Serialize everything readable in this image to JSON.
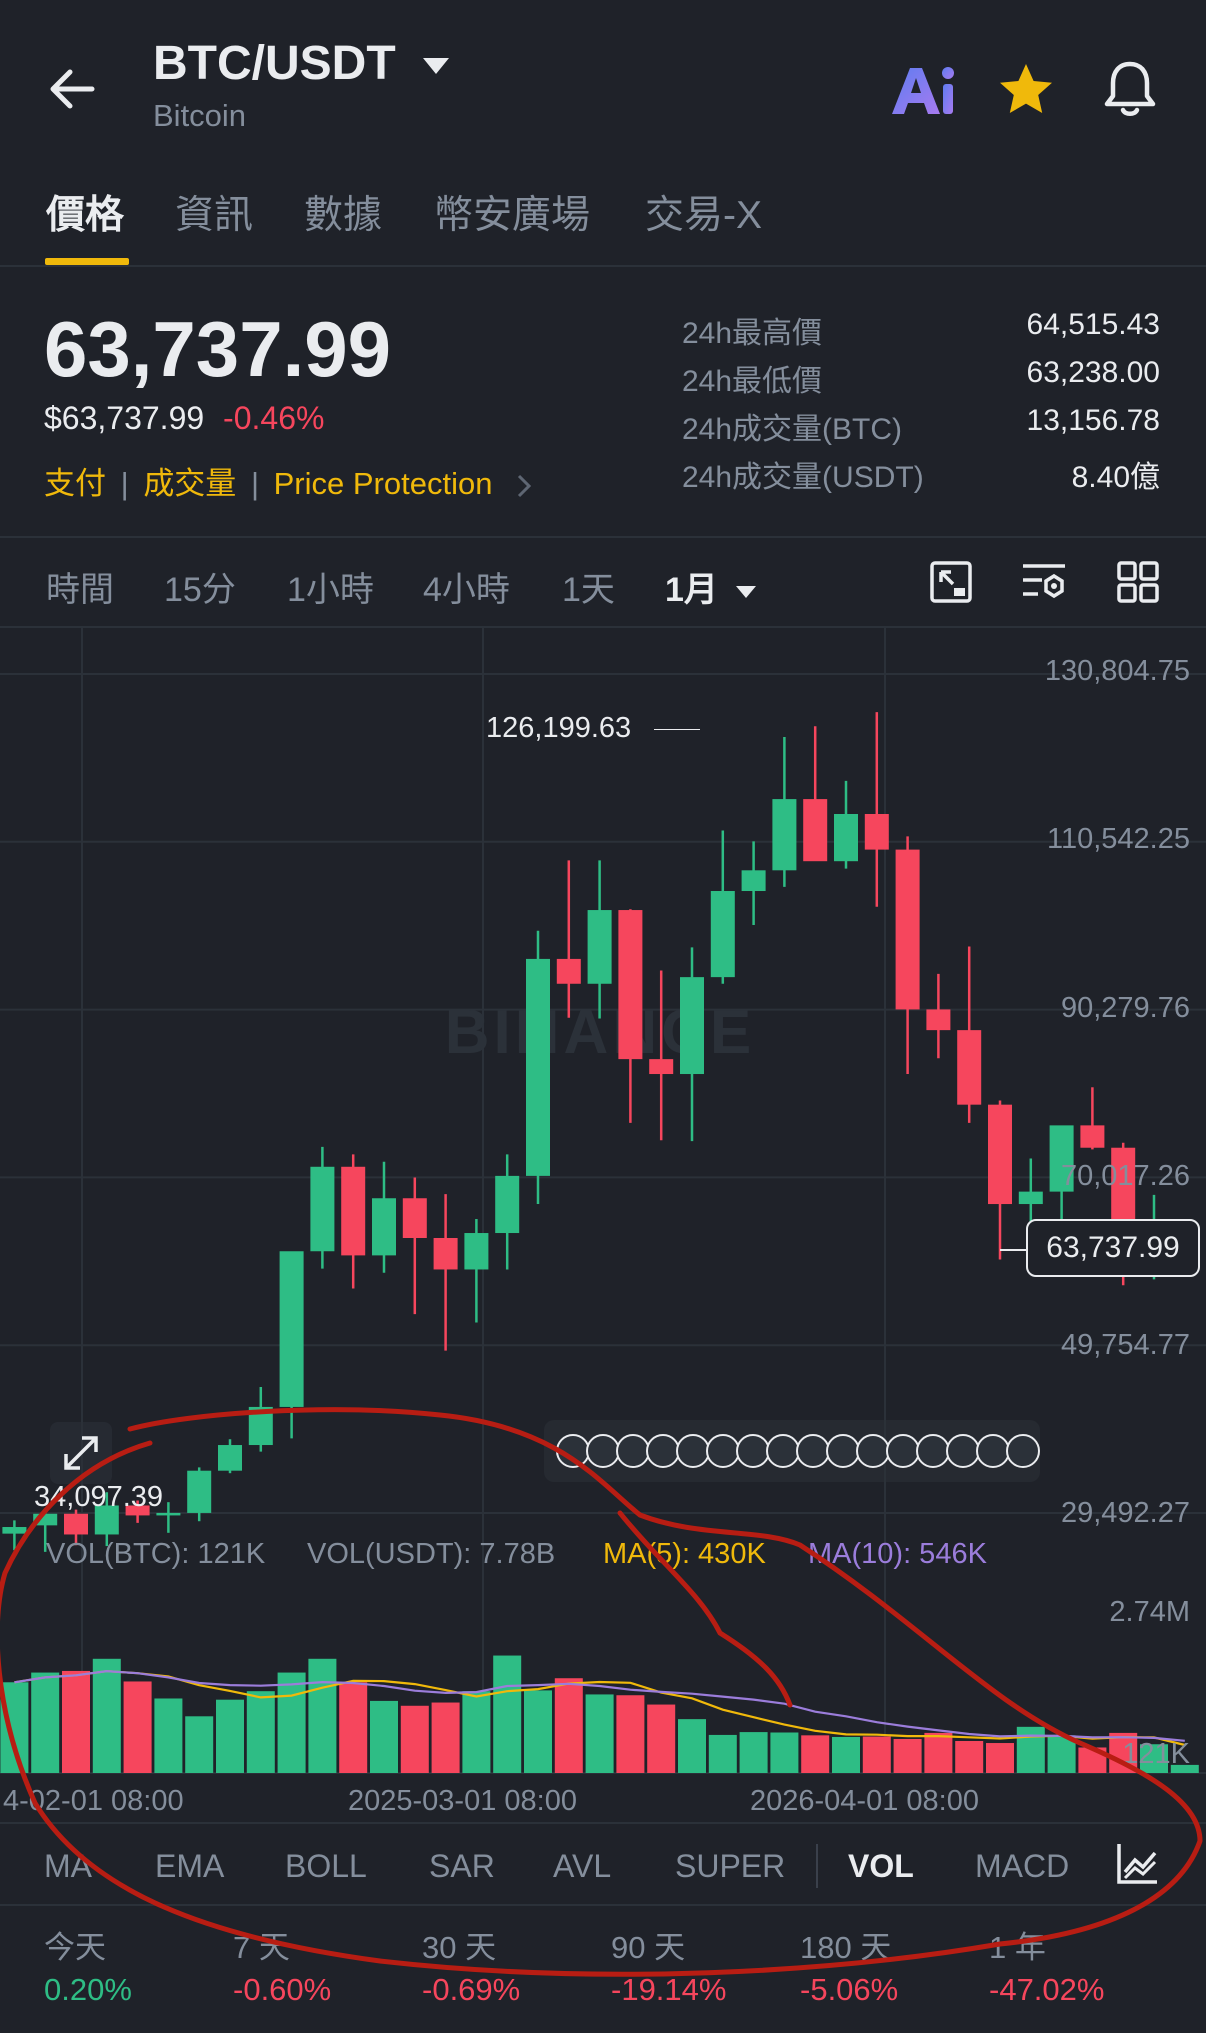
{
  "header": {
    "pair": "BTC/USDT",
    "name": "Bitcoin"
  },
  "tabs": [
    "價格",
    "資訊",
    "數據",
    "幣安廣場",
    "交易-X"
  ],
  "price": {
    "last": "63,737.99",
    "usd": "$63,737.99",
    "change": "-0.46%",
    "links": [
      "支付",
      "成交量",
      "Price Protection"
    ]
  },
  "stats": [
    {
      "label": "24h最高價",
      "value": "64,515.43"
    },
    {
      "label": "24h最低價",
      "value": "63,238.00"
    },
    {
      "label": "24h成交量(BTC)",
      "value": "13,156.78"
    },
    {
      "label": "24h成交量(USDT)",
      "value": "8.40億"
    }
  ],
  "intervals": [
    "時間",
    "15分",
    "1小時",
    "4小時",
    "1天",
    "1月"
  ],
  "chart_data": {
    "type": "candlestick",
    "interval": "1月",
    "watermark": "BINANCE",
    "y_ticks": [
      "130,804.75",
      "110,542.25",
      "90,279.76",
      "70,017.26",
      "49,754.77",
      "29,492.27"
    ],
    "ylim": [
      29492.27,
      130804.75
    ],
    "x_ticks": [
      "4-02-01 08:00",
      "2025-03-01 08:00",
      "2026-04-01 08:00"
    ],
    "high_label": "126,199.63",
    "low_label": "34,097.39",
    "last_price_label": "63,737.99",
    "candles": [
      {
        "o": 27000,
        "h": 28600,
        "l": 25000,
        "c": 27800
      },
      {
        "o": 28000,
        "h": 30000,
        "l": 24800,
        "c": 29400
      },
      {
        "o": 29400,
        "h": 29900,
        "l": 25600,
        "c": 26900
      },
      {
        "o": 26900,
        "h": 32000,
        "l": 25500,
        "c": 30400
      },
      {
        "o": 30400,
        "h": 31000,
        "l": 28300,
        "c": 29200
      },
      {
        "o": 29200,
        "h": 30800,
        "l": 27100,
        "c": 29500
      },
      {
        "o": 29500,
        "h": 35000,
        "l": 28500,
        "c": 34600
      },
      {
        "o": 34600,
        "h": 38400,
        "l": 34300,
        "c": 37700
      },
      {
        "o": 37700,
        "h": 44700,
        "l": 36900,
        "c": 42300
      },
      {
        "o": 42300,
        "h": 48900,
        "l": 38500,
        "c": 61100
      },
      {
        "o": 61100,
        "h": 73700,
        "l": 59000,
        "c": 71300
      },
      {
        "o": 71300,
        "h": 72800,
        "l": 56600,
        "c": 60600
      },
      {
        "o": 60600,
        "h": 71900,
        "l": 58500,
        "c": 67500
      },
      {
        "o": 67500,
        "h": 70000,
        "l": 53500,
        "c": 62700
      },
      {
        "o": 62700,
        "h": 68000,
        "l": 49100,
        "c": 58900
      },
      {
        "o": 58900,
        "h": 65000,
        "l": 52500,
        "c": 63300
      },
      {
        "o": 63300,
        "h": 72800,
        "l": 58900,
        "c": 70200
      },
      {
        "o": 70200,
        "h": 99800,
        "l": 66800,
        "c": 96400
      },
      {
        "o": 96400,
        "h": 108300,
        "l": 89300,
        "c": 93400
      },
      {
        "o": 93400,
        "h": 108300,
        "l": 89200,
        "c": 102300
      },
      {
        "o": 102300,
        "h": 102400,
        "l": 76600,
        "c": 84300
      },
      {
        "o": 84300,
        "h": 95000,
        "l": 74500,
        "c": 82500
      },
      {
        "o": 82500,
        "h": 97800,
        "l": 74400,
        "c": 94200
      },
      {
        "o": 94200,
        "h": 111900,
        "l": 93400,
        "c": 104600
      },
      {
        "o": 104600,
        "h": 110600,
        "l": 100500,
        "c": 107100
      },
      {
        "o": 107100,
        "h": 123200,
        "l": 105100,
        "c": 115700
      },
      {
        "o": 115700,
        "h": 124500,
        "l": 108700,
        "c": 108200
      },
      {
        "o": 108200,
        "h": 117900,
        "l": 107300,
        "c": 113900
      },
      {
        "o": 113900,
        "h": 126199.63,
        "l": 102700,
        "c": 109600
      },
      {
        "o": 109600,
        "h": 111200,
        "l": 82500,
        "c": 90300
      },
      {
        "o": 90300,
        "h": 94600,
        "l": 84400,
        "c": 87800
      },
      {
        "o": 87800,
        "h": 97900,
        "l": 76600,
        "c": 78800
      },
      {
        "o": 78800,
        "h": 79300,
        "l": 60100,
        "c": 66800
      },
      {
        "o": 66800,
        "h": 72300,
        "l": 62400,
        "c": 68300
      },
      {
        "o": 68300,
        "h": 76000,
        "l": 65000,
        "c": 76300
      },
      {
        "o": 76300,
        "h": 80900,
        "l": 73400,
        "c": 73600
      },
      {
        "o": 73600,
        "h": 74200,
        "l": 57000,
        "c": 58900
      },
      {
        "o": 58900,
        "h": 67900,
        "l": 57700,
        "c": 62400
      },
      {
        "o": 63100,
        "h": 64515.43,
        "l": 62300,
        "c": 63737.99
      }
    ],
    "volume": {
      "legend": {
        "vol_btc": "VOL(BTC): 121K",
        "vol_usdt": "VOL(USDT): 7.78B",
        "ma5": "MA(5): 430K",
        "ma10": "MA(10): 546K"
      },
      "y_ticks": [
        "2.74M",
        "121K"
      ],
      "values": [
        1120,
        1240,
        1260,
        1410,
        1130,
        920,
        700,
        905,
        1010,
        1240,
        1410,
        1120,
        890,
        830,
        870,
        1010,
        1450,
        1020,
        1170,
        970,
        960,
        845,
        665,
        470,
        505,
        500,
        465,
        445,
        450,
        420,
        495,
        395,
        370,
        570,
        465,
        315,
        495,
        355,
        100
      ]
    }
  },
  "indicators": [
    "MA",
    "EMA",
    "BOLL",
    "SAR",
    "AVL",
    "SUPER",
    "VOL",
    "MACD"
  ],
  "indicator_active": "VOL",
  "performance": [
    {
      "label": "今天",
      "value": "0.20%"
    },
    {
      "label": "7 天",
      "value": "-0.60%"
    },
    {
      "label": "30 天",
      "value": "-0.69%"
    },
    {
      "label": "90 天",
      "value": "-19.14%"
    },
    {
      "label": "180 天",
      "value": "-5.06%"
    },
    {
      "label": "1 年",
      "value": "-47.02%"
    }
  ],
  "colors": {
    "up": "#2ebd85",
    "down": "#f6465d",
    "accent": "#f0b90b",
    "background": "#1f2229",
    "ma5": "#f0b90b",
    "ma10": "#9b7ddb",
    "annotation": "#b81d13"
  },
  "icons": [
    "back-arrow-icon",
    "caret-down-icon",
    "ai-icon",
    "star-icon",
    "bell-icon",
    "chevron-right-icon",
    "expand-icon",
    "chart-settings-icon",
    "grid-icon",
    "fullscreen-arrow-icon",
    "globe-icon",
    "indicator-settings-icon"
  ]
}
